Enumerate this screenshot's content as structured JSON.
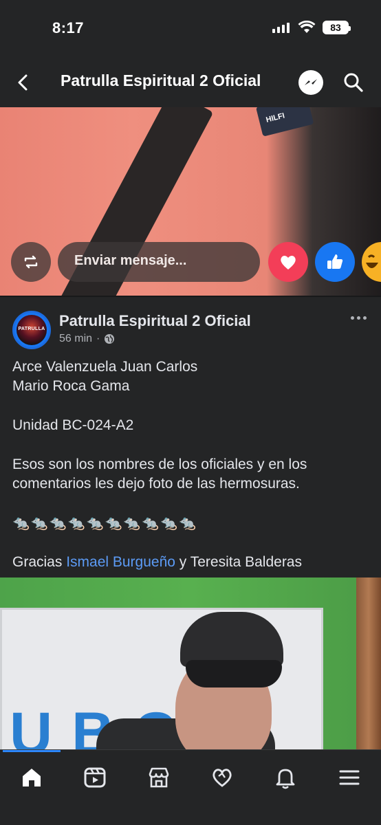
{
  "status": {
    "time": "8:17",
    "battery": "83"
  },
  "nav": {
    "title": "Patrulla Espiritual 2 Oficial"
  },
  "video": {
    "message_placeholder": "Enviar mensaje...",
    "shirt_logo_text": "HILFI"
  },
  "post": {
    "author": "Patrulla Espiritual 2 Oficial",
    "avatar_text": "PATRULLA",
    "time": "56 min",
    "meta_separator": "·",
    "lines": {
      "l1": "Arce Valenzuela Juan Carlos",
      "l2": "Mario Roca Gama",
      "l3": "Unidad BC-024-A2",
      "l4": "Esos son los nombres de los oficiales y en los comentarios les dejo foto de las hermosuras.",
      "rats": "🐀🐀🐀🐀🐀🐀🐀🐀🐀🐀",
      "thanks_prefix": "Gracias ",
      "thanks_mention": "Ismael Burgueño",
      "thanks_suffix": " y Teresita Balderas"
    }
  },
  "photo": {
    "sign_letters": "UBCH"
  },
  "colors": {
    "background": "#242526",
    "text": "#e4e6eb",
    "secondary_text": "#b0b3b8",
    "link": "#5c9bf5",
    "love": "#f33e58",
    "like": "#1877f2",
    "active_tab": "#2d88ff"
  },
  "tabs": [
    {
      "icon": "home-icon",
      "active": true
    },
    {
      "icon": "video-icon",
      "active": false
    },
    {
      "icon": "marketplace-icon",
      "active": false
    },
    {
      "icon": "dating-icon",
      "active": false
    },
    {
      "icon": "notifications-icon",
      "active": false
    },
    {
      "icon": "menu-icon",
      "active": false
    }
  ]
}
